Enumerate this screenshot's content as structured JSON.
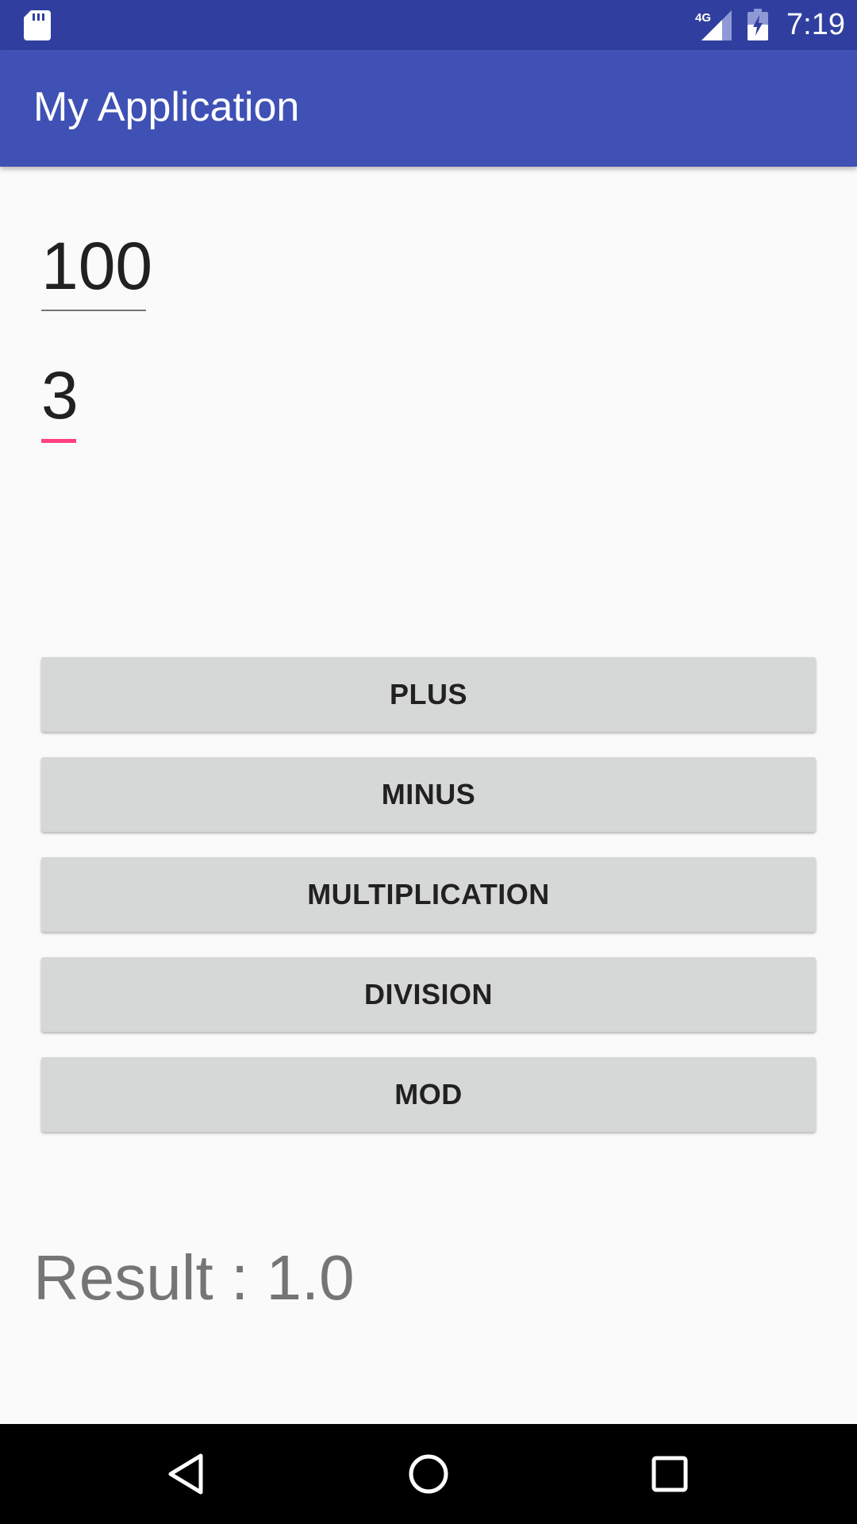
{
  "status_bar": {
    "time": "7:19",
    "network_label": "4G",
    "icons": [
      "sd-card-icon",
      "signal-4g-icon",
      "battery-charging-icon"
    ]
  },
  "app_bar": {
    "title": "My Application",
    "color": "#3f51b5"
  },
  "inputs": {
    "first_value": "100",
    "second_value": "3",
    "focused_field": "second",
    "accent_color": "#ff4081"
  },
  "buttons": {
    "plus": "PLUS",
    "minus": "MINUS",
    "multiplication": "MULTIPLICATION",
    "division": "DIVISION",
    "mod": "MOD"
  },
  "result": {
    "text": "Result : 1.0"
  },
  "nav_bar": {
    "icons": [
      "back-icon",
      "home-icon",
      "recents-icon"
    ]
  }
}
